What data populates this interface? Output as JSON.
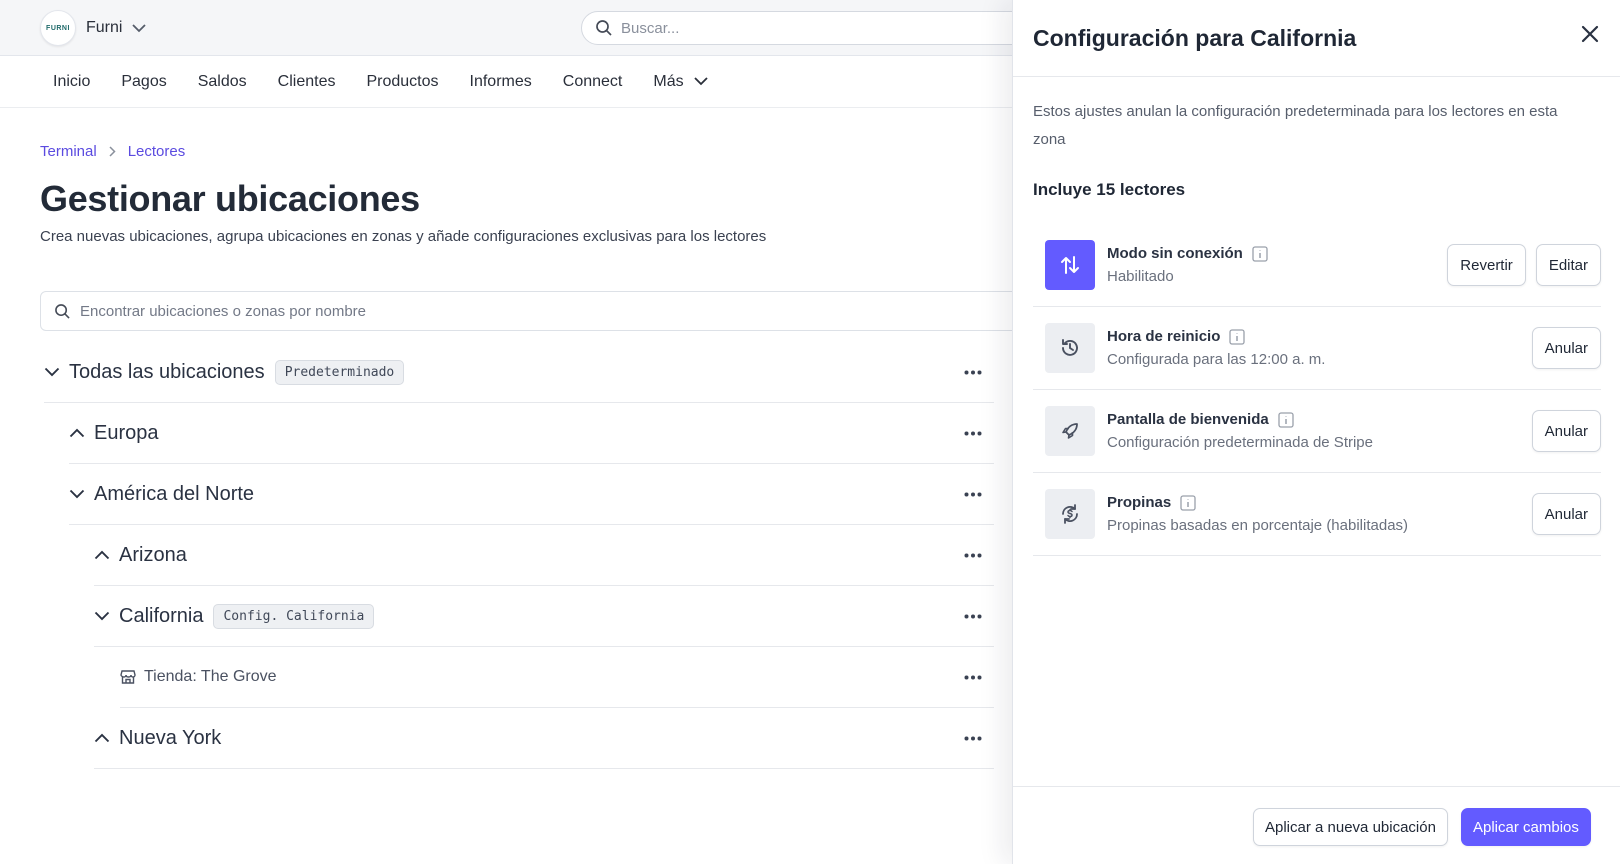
{
  "brand": {
    "logo_text": "FURNI",
    "name": "Furni"
  },
  "global_search": {
    "placeholder": "Buscar..."
  },
  "nav": {
    "items": [
      "Inicio",
      "Pagos",
      "Saldos",
      "Clientes",
      "Productos",
      "Informes",
      "Connect",
      "Más"
    ]
  },
  "breadcrumb": [
    "Terminal",
    "Lectores"
  ],
  "page": {
    "title": "Gestionar ubicaciones",
    "subtitle": "Crea nuevas ubicaciones, agrupa ubicaciones en zonas y añade configuraciones exclusivas para los lectores"
  },
  "location_search": {
    "placeholder": "Encontrar ubicaciones o zonas por nombre"
  },
  "tree": [
    {
      "label": "Todas las ubicaciones",
      "badge": "Predeterminado",
      "level": 0,
      "expanded": true
    },
    {
      "label": "Europa",
      "level": 1,
      "expanded": false
    },
    {
      "label": "América del Norte",
      "level": 1,
      "expanded": true
    },
    {
      "label": "Arizona",
      "level": 2,
      "expanded": false
    },
    {
      "label": "California",
      "badge": "Config. California",
      "level": 2,
      "expanded": true
    },
    {
      "label": "Tienda: The Grove",
      "level": 3,
      "type": "store"
    },
    {
      "label": "Nueva York",
      "level": 2,
      "expanded": false
    }
  ],
  "panel": {
    "title": "Configuración para California",
    "description": "Estos ajustes anulan la configuración predeterminada para los lectores en esta zona",
    "count_label": "Incluye 15 lectores",
    "settings": [
      {
        "title": "Modo sin conexión",
        "value": "Habilitado",
        "icon": "arrows-up-down-icon",
        "actions": [
          "Revertir",
          "Editar"
        ]
      },
      {
        "title": "Hora de reinicio",
        "value": "Configurada para las 12:00 a. m.",
        "icon": "history-clock-icon",
        "actions": [
          "Anular"
        ]
      },
      {
        "title": "Pantalla de bienvenida",
        "value": "Configuración predeterminada de Stripe",
        "icon": "rocket-icon",
        "actions": [
          "Anular"
        ]
      },
      {
        "title": "Propinas",
        "value": "Propinas basadas en porcentaje (habilitadas)",
        "icon": "tip-cycle-icon",
        "actions": [
          "Anular"
        ]
      }
    ],
    "footer": {
      "secondary": "Aplicar a nueva ubicación",
      "primary": "Aplicar cambios"
    }
  },
  "colors": {
    "accent": "#635bff",
    "link": "#5b4be0",
    "text": "#1f2735"
  }
}
